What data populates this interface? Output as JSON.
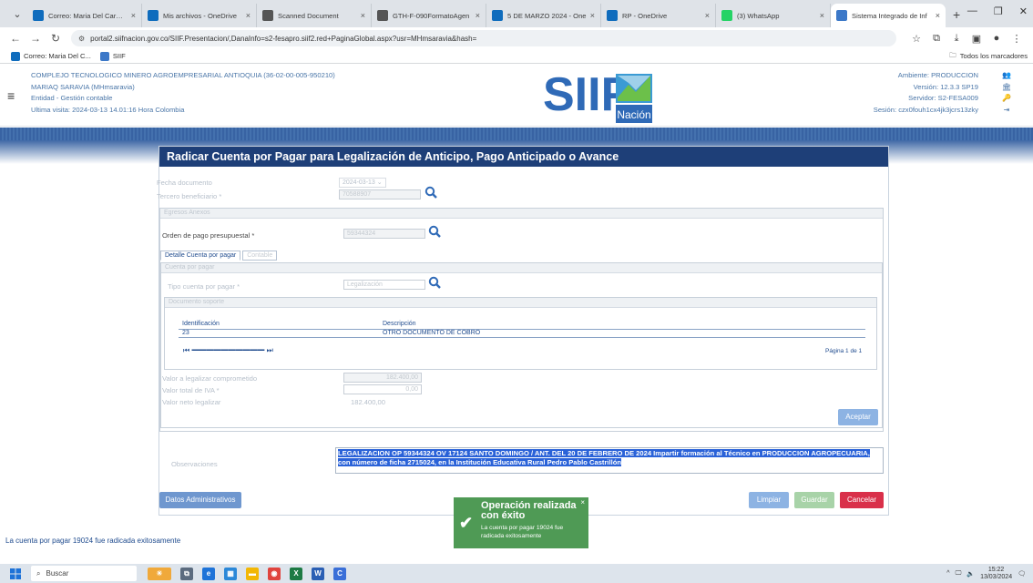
{
  "browser": {
    "tabs": [
      {
        "title": "Correo: Maria Del Carmen",
        "fav_color": "#0f6cbd",
        "active": false
      },
      {
        "title": "Mis archivos - OneDrive",
        "fav_color": "#0f6cbd",
        "active": false
      },
      {
        "title": "Scanned Document",
        "fav_color": "#555555",
        "active": false
      },
      {
        "title": "GTH-F-090FormatoAgen",
        "fav_color": "#555555",
        "active": false
      },
      {
        "title": "5 DE MARZO 2024 - One",
        "fav_color": "#0f6cbd",
        "active": false
      },
      {
        "title": "RP - OneDrive",
        "fav_color": "#0f6cbd",
        "active": false
      },
      {
        "title": "(3) WhatsApp",
        "fav_color": "#25d366",
        "active": false
      },
      {
        "title": "Sistema Integrado de Inf",
        "fav_color": "#3c78c8",
        "active": true
      }
    ],
    "url": "portal2.siifnacion.gov.co/SIIF.Presentacion/,DanaInfo=s2-fesapro.siif2.red+PaginaGlobal.aspx?usr=MHmsaravia&hash=",
    "bookmarks": [
      {
        "label": "Correo: Maria Del C...",
        "color": "#0f6cbd"
      },
      {
        "label": "SIIF",
        "color": "#3c78c8"
      }
    ],
    "all_bookmarks": "Todos los marcadores"
  },
  "header": {
    "org": "COMPLEJO TECNOLOGICO MINERO AGROEMPRESARIAL ANTIOQUIA (36-02-00-005-950210)",
    "user": "MARIAQ SARAVIA (MHmsaravia)",
    "entity": "Entidad - Gestión contable",
    "last_visit": "Ultima visita: 2024-03-13 14.01:16 Hora Colombia",
    "logo_text": "SIIF",
    "logo_sub": "Nación",
    "environment": "Ambiente: PRODUCCION",
    "version": "Versión: 12.3.3 SP19",
    "server": "Servidor: S2-FESA009",
    "session": "Sesión: czx0fouh1cx4jk3jcrs13zky"
  },
  "form": {
    "title": "Radicar Cuenta por Pagar para Legalización de Anticipo, Pago Anticipado o Avance",
    "fecha_label": "Fecha documento",
    "fecha_value": "2024-03-13",
    "tercero_label": "Tercero beneficiario *",
    "tercero_value": "70588907",
    "egreso_section": "Egresos Anexos",
    "orden_label": "Orden de pago presupuestal *",
    "orden_value": "59344324",
    "tab_detalle": "Detalle Cuenta por pagar",
    "tab_contable": "Contable",
    "cuenta_section": "Cuenta por pagar",
    "tipo_label": "Tipo cuenta por pagar *",
    "tipo_value": "Legalización",
    "docs_section": "Documento soporte",
    "grid_headers": [
      "Identificación",
      "Descripción"
    ],
    "grid_rows": [
      [
        "23",
        "OTRO DOCUMENTO DE COBRO"
      ]
    ],
    "page_info": "Página 1 de 1",
    "valor_legalizar_label": "Valor a legalizar comprometido",
    "valor_legalizar_value": "182.400,00",
    "valor_iva_label": "Valor total de IVA *",
    "valor_iva_value": "0,00",
    "valor_neto_label": "Valor neto legalizar",
    "valor_neto_value": "182.400,00",
    "aceptar_button": "Aceptar",
    "obs_label": "Observaciones",
    "obs_text": "LEGALIZACION OP 59344324 OV 17124 SANTO DOMINGO / ANT. DEL 20 DE FEBRERO DE 2024 Impartir formación al Técnico en PRODUCCION AGROPECUARIA, con número de ficha 2715024, en la Institución Educativa Rural Pedro Pablo Castrillón",
    "datos_admin_button": "Datos Administrativos",
    "limpiar_button": "Limpiar",
    "guardar_button": "Guardar",
    "cancelar_button": "Cancelar"
  },
  "toast": {
    "title": "Operación realizada con éxito",
    "message": "La cuenta por pagar 19024 fue radicada exitosamente"
  },
  "status_message": "La cuenta por pagar 19024 fue radicada exitosamente",
  "taskbar": {
    "search": "Buscar",
    "time": "15:22",
    "date": "13/03/2024"
  }
}
